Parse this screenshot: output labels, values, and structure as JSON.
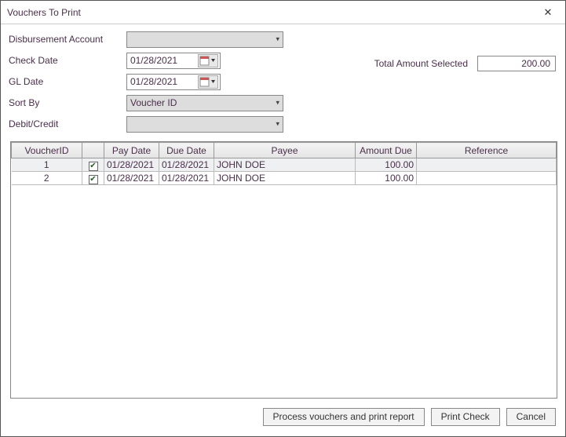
{
  "window": {
    "title": "Vouchers To Print"
  },
  "form": {
    "disbursement_label": "Disbursement Account",
    "disbursement_value": "",
    "check_date_label": "Check Date",
    "check_date_value": "01/28/2021",
    "gl_date_label": "GL Date",
    "gl_date_value": "01/28/2021",
    "sort_by_label": "Sort By",
    "sort_by_value": "Voucher ID",
    "debit_credit_label": "Debit/Credit",
    "debit_credit_value": "",
    "total_label": "Total Amount Selected",
    "total_value": "200.00"
  },
  "grid": {
    "headers": {
      "voucher_id": "VoucherID",
      "check": "",
      "pay_date": "Pay Date",
      "due_date": "Due Date",
      "payee": "Payee",
      "amount": "Amount Due",
      "reference": "Reference"
    },
    "rows": [
      {
        "voucher_id": "1",
        "checked": true,
        "pay_date": "01/28/2021",
        "due_date": "01/28/2021",
        "payee": "JOHN DOE",
        "amount": "100.00",
        "reference": ""
      },
      {
        "voucher_id": "2",
        "checked": true,
        "pay_date": "01/28/2021",
        "due_date": "01/28/2021",
        "payee": "JOHN DOE",
        "amount": "100.00",
        "reference": ""
      }
    ]
  },
  "buttons": {
    "process": "Process vouchers and print report",
    "print": "Print Check",
    "cancel": "Cancel"
  }
}
